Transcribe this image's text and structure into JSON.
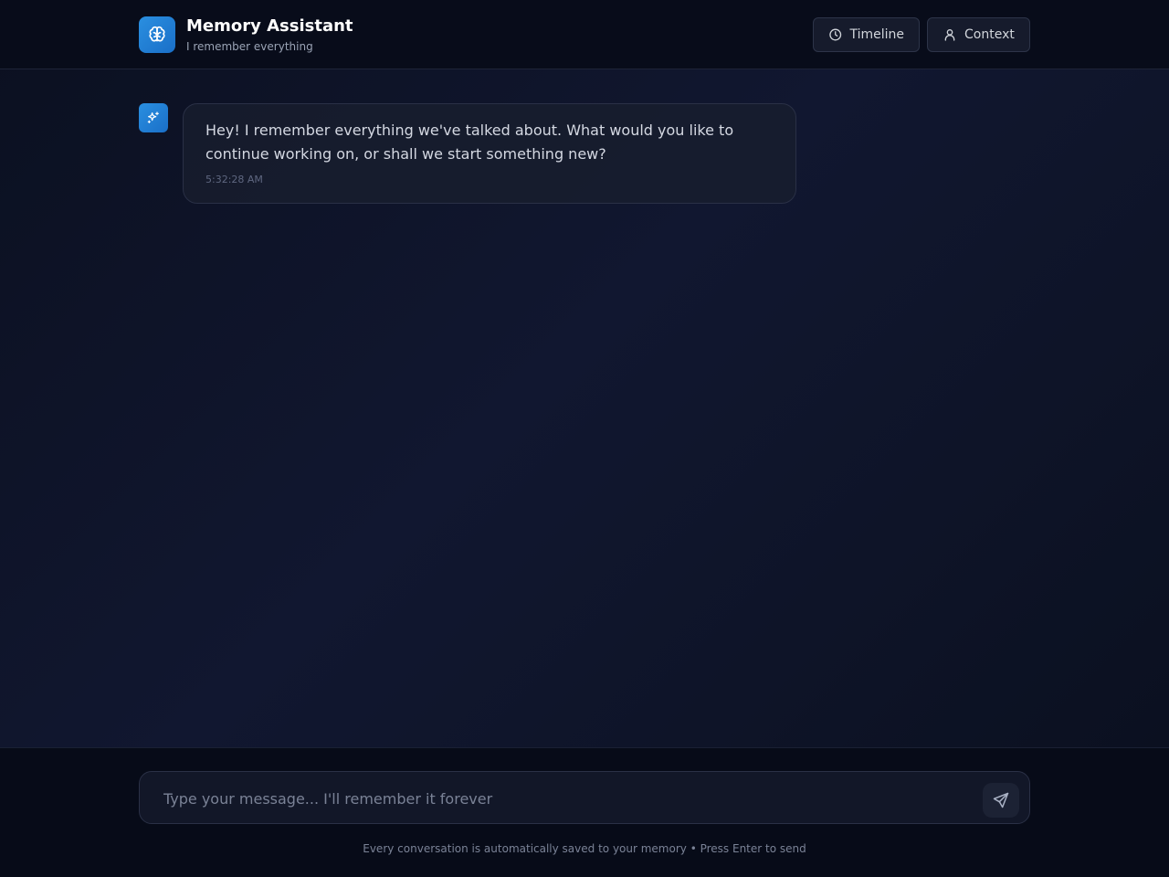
{
  "header": {
    "title": "Memory Assistant",
    "subtitle": "I remember everything",
    "logo_icon": "brain-icon",
    "buttons": [
      {
        "label": "Timeline",
        "icon": "clock-icon"
      },
      {
        "label": "Context",
        "icon": "user-icon"
      }
    ]
  },
  "conversation": {
    "messages": [
      {
        "role": "assistant",
        "avatar_icon": "sparkles-icon",
        "text": "Hey! I remember everything we've talked about. What would you like to continue working on, or shall we start something new?",
        "time": "5:32:28 AM"
      }
    ]
  },
  "composer": {
    "placeholder": "Type your message... I'll remember it forever",
    "value": "",
    "send_icon": "send-icon"
  },
  "footer": {
    "note": "Every conversation is automatically saved to your memory • Press Enter to send"
  },
  "colors": {
    "accent": "#1f86d8",
    "background": "#0f1428",
    "header_bg": "#080c1a"
  }
}
